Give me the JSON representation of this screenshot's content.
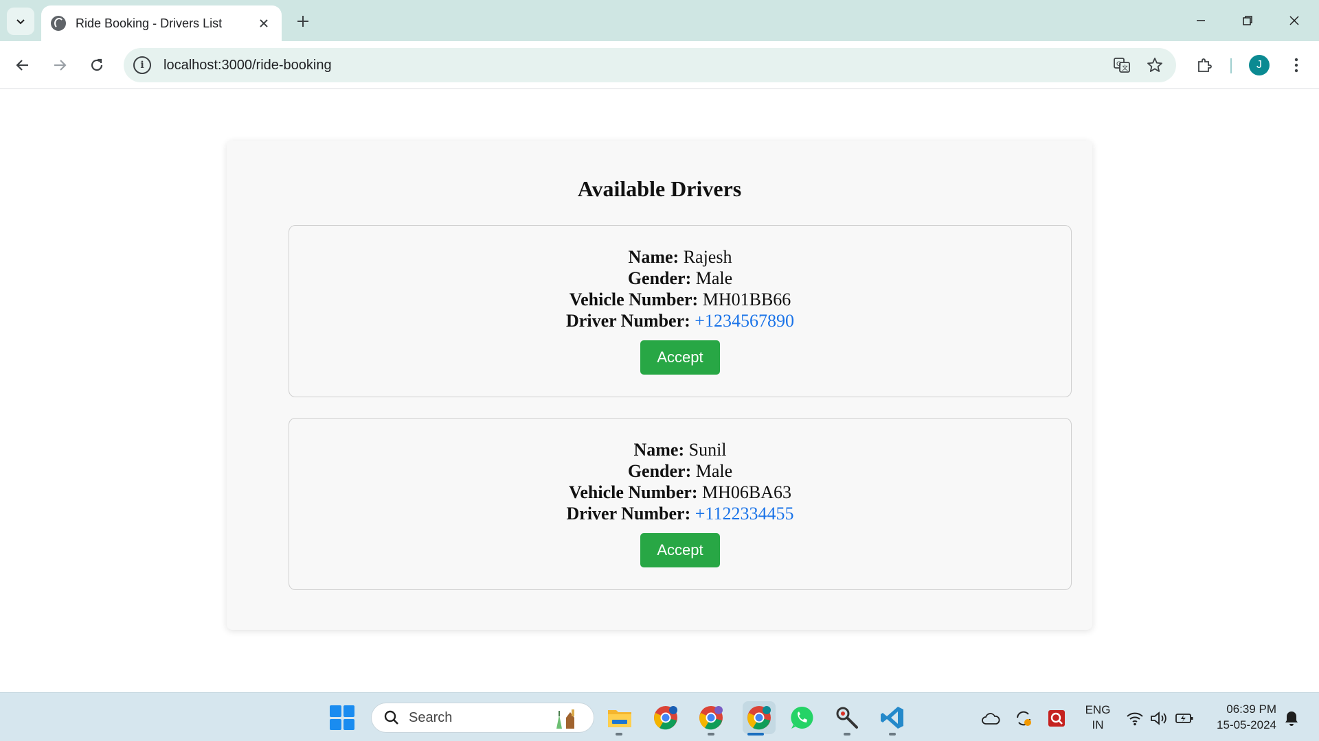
{
  "browser": {
    "tab_title": "Ride Booking - Drivers List",
    "url": "localhost:3000/ride-booking",
    "profile_initial": "J"
  },
  "page": {
    "title": "Available Drivers",
    "drivers": [
      {
        "name_label": "Name:",
        "name": "Rajesh",
        "gender_label": "Gender:",
        "gender": "Male",
        "vehicle_label": "Vehicle Number:",
        "vehicle": "MH01BB66",
        "phone_label": "Driver Number:",
        "phone": "+1234567890",
        "button": "Accept"
      },
      {
        "name_label": "Name:",
        "name": "Sunil",
        "gender_label": "Gender:",
        "gender": "Male",
        "vehicle_label": "Vehicle Number:",
        "vehicle": "MH06BA63",
        "phone_label": "Driver Number:",
        "phone": "+1122334455",
        "button": "Accept"
      }
    ]
  },
  "taskbar": {
    "search_placeholder": "Search",
    "lang_line1": "ENG",
    "lang_line2": "IN",
    "time": "06:39 PM",
    "date": "15-05-2024",
    "apps": [
      "file-explorer",
      "chrome-profile-1",
      "chrome-profile-2",
      "chrome-active",
      "whatsapp",
      "snipping-tool",
      "vscode"
    ]
  },
  "colors": {
    "accept_button": "#28a745",
    "phone_link": "#1a73e8",
    "tab_strip": "#cfe6e3",
    "taskbar": "#d6e6ee"
  }
}
